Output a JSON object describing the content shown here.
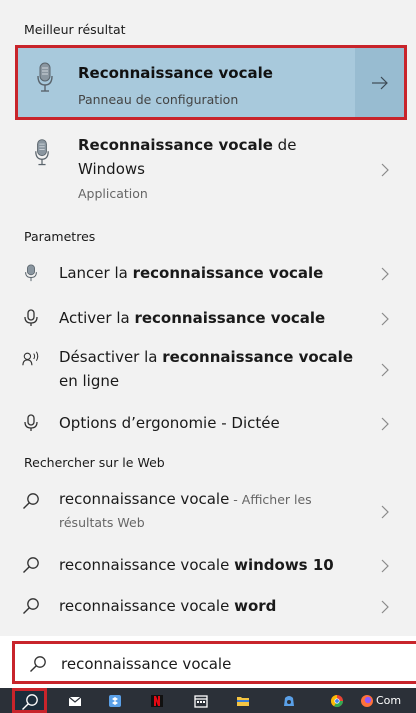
{
  "sections": {
    "best": "Meilleur résultat",
    "settings": "Parametres",
    "web": "Rechercher sur le Web"
  },
  "best_result": {
    "title": "Reconnaissance vocale",
    "subtitle": "Panneau de configuration",
    "icon": "microphone-icon"
  },
  "app_result": {
    "title_bold": "Reconnaissance vocale",
    "title_rest": " de",
    "title_line2": "Windows",
    "subtitle": "Application",
    "icon": "microphone-icon"
  },
  "settings_items": [
    {
      "pre": "Lancer la ",
      "bold": "reconnaissance vocale",
      "post": "",
      "icon": "microphone-icon"
    },
    {
      "pre": "Activer la ",
      "bold": "reconnaissance vocale",
      "post": "",
      "icon": "microphone-outline-icon"
    },
    {
      "pre": "Désactiver la ",
      "bold": "reconnaissance vocale",
      "post": "",
      "line2": "en ligne",
      "icon": "voice-person-icon"
    },
    {
      "pre": "Options d’ergonomie - Dictée",
      "bold": "",
      "post": "",
      "icon": "microphone-outline-icon"
    }
  ],
  "web_items": [
    {
      "pre": "reconnaissance vocale",
      "suffix": " - Afficher les",
      "line2": "résultats Web",
      "bold": ""
    },
    {
      "pre": "reconnaissance vocale ",
      "bold": "windows 10"
    },
    {
      "pre": "reconnaissance vocale ",
      "bold": "word"
    }
  ],
  "search": {
    "value": "reconnaissance vocale"
  },
  "taskbar": {
    "partial_label": "Com",
    "icons": [
      "search-icon",
      "mail-icon",
      "dropbox-icon",
      "netflix-icon",
      "calendar-icon",
      "file-explorer-icon",
      "store-icon",
      "chrome-icon",
      "firefox-icon"
    ]
  },
  "colors": {
    "highlight": "#a8c9dc",
    "annotation_red": "#c8242b",
    "taskbar": "#2b3038"
  }
}
